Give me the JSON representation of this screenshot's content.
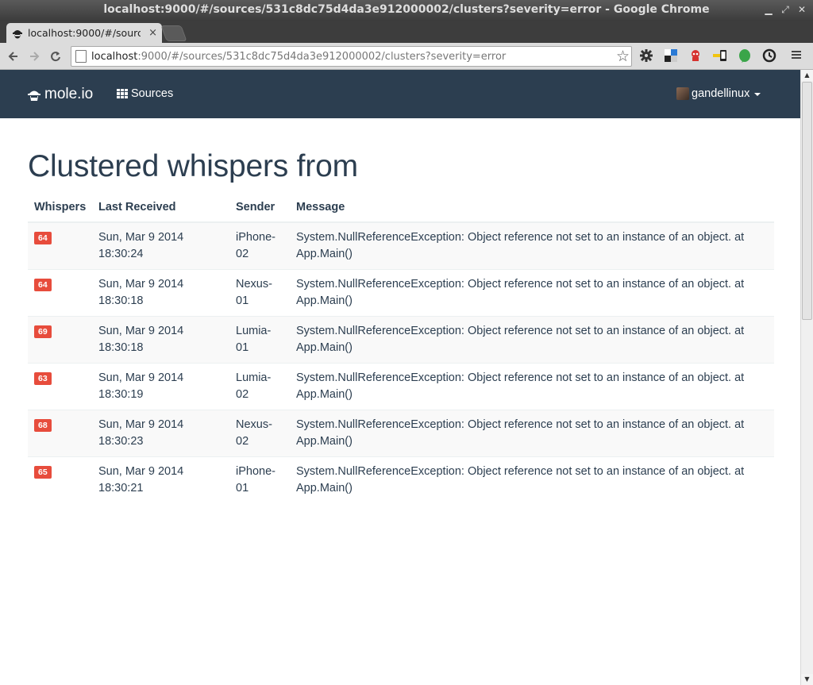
{
  "window": {
    "title": "localhost:9000/#/sources/531c8dc75d4da3e912000002/clusters?severity=error - Google Chrome"
  },
  "tab": {
    "label": "localhost:9000/#/sourc",
    "close": "×"
  },
  "toolbar": {
    "url_host": "localhost",
    "url_rest": ":9000/#/sources/531c8dc75d4da3e912000002/clusters?severity=error",
    "back_icon": "arrow-left-icon",
    "forward_icon": "arrow-right-icon",
    "reload_icon": "reload-icon"
  },
  "navbar": {
    "brand": "mole.io",
    "sources_label": "Sources",
    "username": "gandellinux"
  },
  "main": {
    "title": "Clustered whispers from",
    "columns": [
      "Whispers",
      "Last Received",
      "Sender",
      "Message"
    ],
    "rows": [
      {
        "count": "64",
        "date": "Sun, Mar 9 2014 18:30:24",
        "sender": "iPhone-02",
        "message": "System.NullReferenceException: Object reference not set to an instance of an object. at App.Main()"
      },
      {
        "count": "64",
        "date": "Sun, Mar 9 2014 18:30:18",
        "sender": "Nexus-01",
        "message": "System.NullReferenceException: Object reference not set to an instance of an object. at App.Main()"
      },
      {
        "count": "69",
        "date": "Sun, Mar 9 2014 18:30:18",
        "sender": "Lumia-01",
        "message": "System.NullReferenceException: Object reference not set to an instance of an object. at App.Main()"
      },
      {
        "count": "63",
        "date": "Sun, Mar 9 2014 18:30:19",
        "sender": "Lumia-02",
        "message": "System.NullReferenceException: Object reference not set to an instance of an object. at App.Main()"
      },
      {
        "count": "68",
        "date": "Sun, Mar 9 2014 18:30:23",
        "sender": "Nexus-02",
        "message": "System.NullReferenceException: Object reference not set to an instance of an object. at App.Main()"
      },
      {
        "count": "65",
        "date": "Sun, Mar 9 2014 18:30:21",
        "sender": "iPhone-01",
        "message": "System.NullReferenceException: Object reference not set to an instance of an object. at App.Main()"
      }
    ]
  },
  "colors": {
    "navbar": "#2c3e50",
    "badge": "#e74c3c",
    "text": "#2c3e50"
  }
}
